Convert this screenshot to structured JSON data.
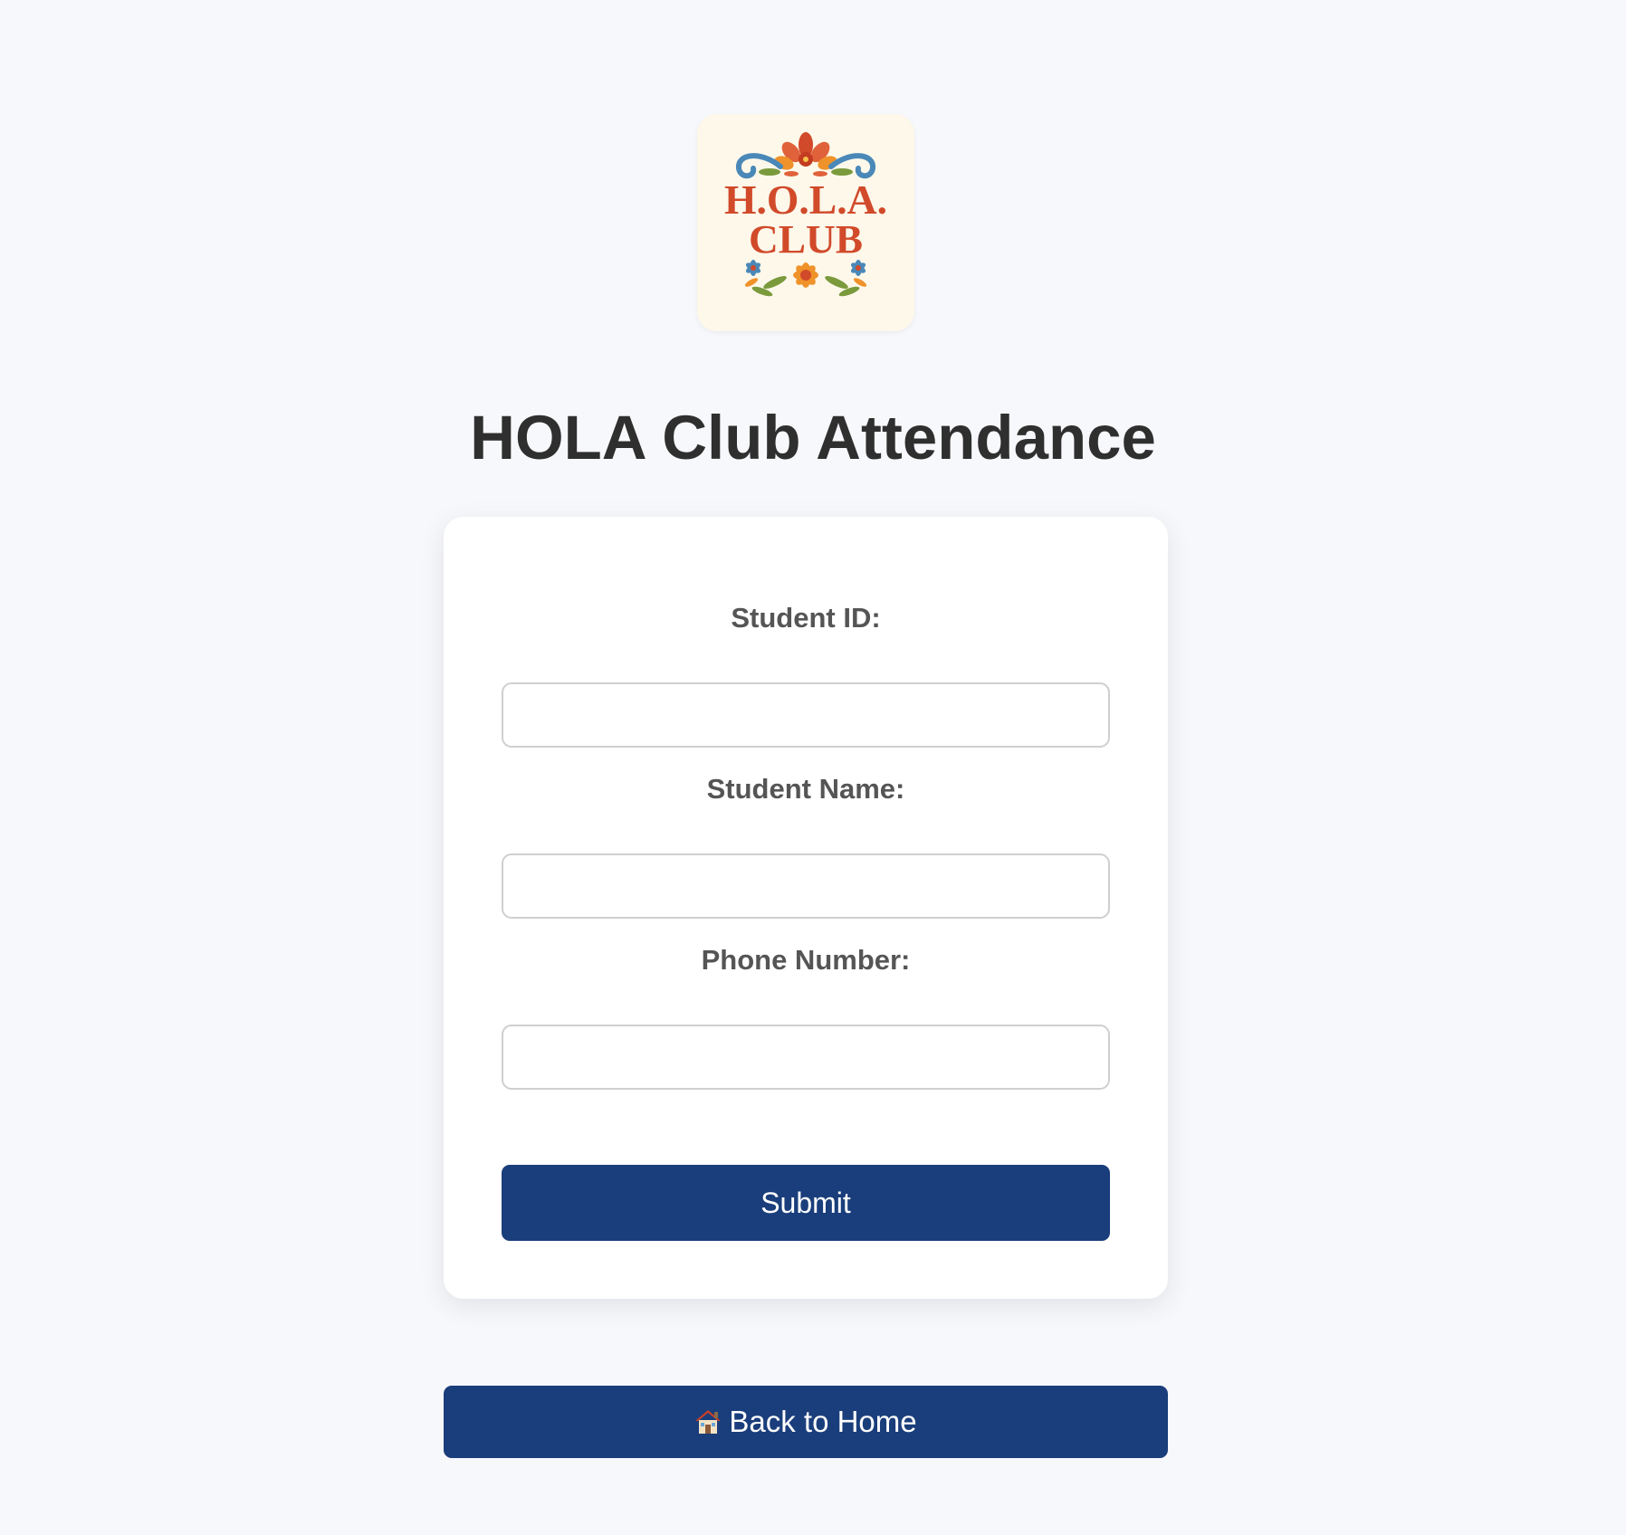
{
  "logo": {
    "line1": "H.O.L.A.",
    "line2": "CLUB"
  },
  "page": {
    "title": "HOLA Club Attendance"
  },
  "form": {
    "fields": [
      {
        "label": "Student ID:",
        "value": "",
        "placeholder": ""
      },
      {
        "label": "Student Name:",
        "value": "",
        "placeholder": ""
      },
      {
        "label": "Phone Number:",
        "value": "",
        "placeholder": ""
      }
    ],
    "submit_label": "Submit"
  },
  "navigation": {
    "home_icon": "house-icon",
    "home_label": "Back to Home"
  },
  "colors": {
    "background": "#f7f8fb",
    "primary": "#1a3e7b",
    "logo_red": "#d14a2a",
    "logo_blue": "#4a88b8",
    "logo_orange": "#f0922a",
    "logo_green": "#7a9a3c"
  }
}
